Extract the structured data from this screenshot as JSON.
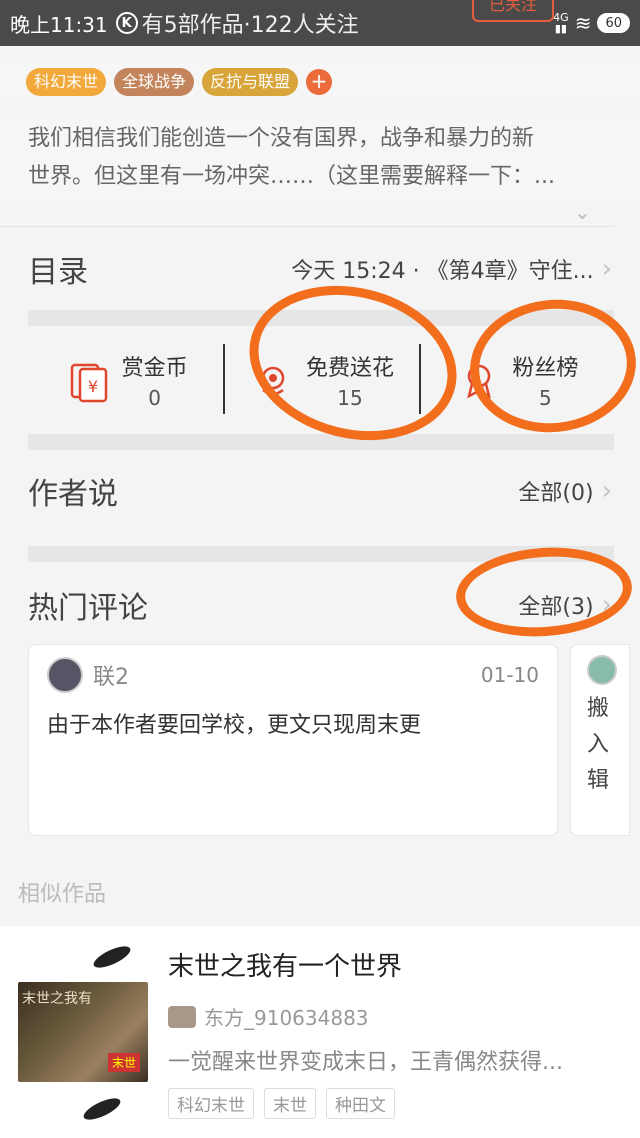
{
  "status_bar": {
    "time": "晚上11:31",
    "k_label": "K",
    "header_info": "有5部作品·122人关注",
    "network": "4G",
    "battery": "60",
    "follow_label": "已关注"
  },
  "tags": [
    "科幻末世",
    "全球战争",
    "反抗与联盟",
    "+"
  ],
  "description": {
    "line1": "我们相信我们能创造一个没有国界，战争和暴力的新",
    "line2": "世界。但这里有一场冲突……（这里需要解释一下：..."
  },
  "catalog": {
    "title": "目录",
    "latest": "今天 15:24 · 《第4章》守住..."
  },
  "stats": [
    {
      "label": "赏金币",
      "value": "0",
      "icon": "red-envelope-yen-icon"
    },
    {
      "label": "免费送花",
      "value": "15",
      "icon": "flower-icon"
    },
    {
      "label": "粉丝榜",
      "value": "5",
      "icon": "medal-icon"
    }
  ],
  "author_says": {
    "title": "作者说",
    "all": "全部(0)"
  },
  "hot_comments": {
    "title": "热门评论",
    "all": "全部(3)",
    "items": [
      {
        "user": "联2",
        "date": "01-10",
        "text": "由于本作者要回学校，更文只现周末更"
      },
      {
        "text": "搬入辑"
      }
    ]
  },
  "similar": {
    "title": "相似作品",
    "book": {
      "title": "末世之我有一个世界",
      "cover_text": "末世之我有",
      "cover_badge": "末世",
      "author": "东方_910634883",
      "desc": "一觉醒来世界变成末日，王青偶然获得...",
      "tags": [
        "科幻末世",
        "末世",
        "种田文"
      ]
    }
  }
}
